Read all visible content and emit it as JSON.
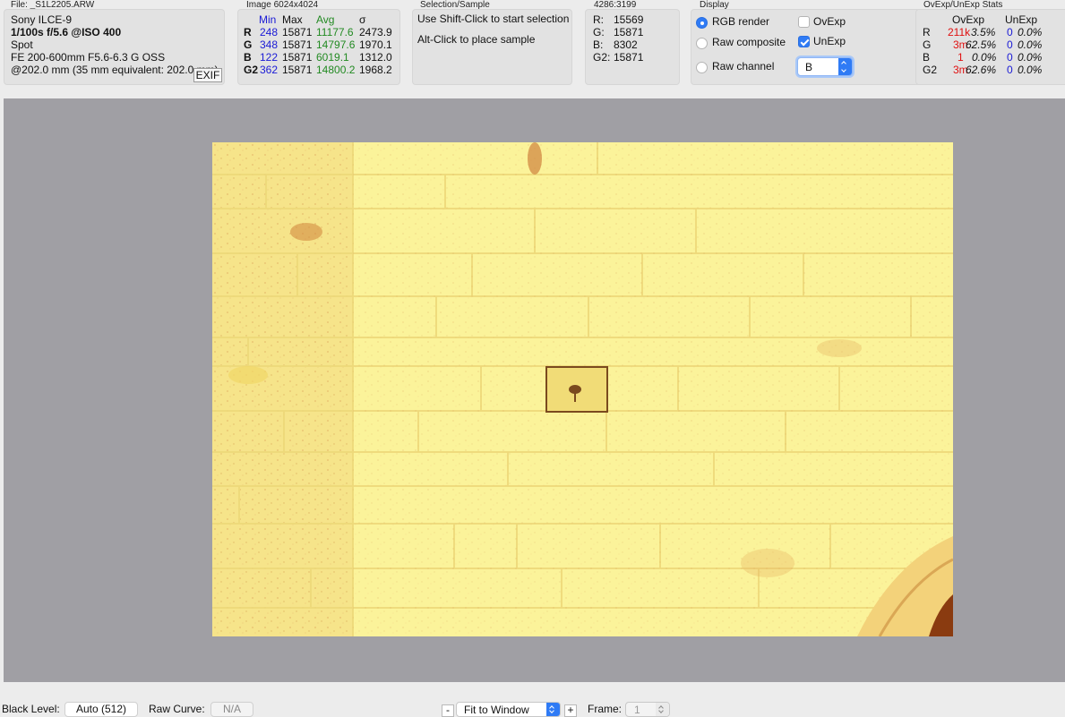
{
  "file_panel": {
    "title": "File: _S1L2205.ARW",
    "camera": "Sony ILCE-9",
    "exposure": "1/100s f/5.6 @ISO 400",
    "metering": "Spot",
    "lens": "FE 200-600mm F5.6-6.3 G OSS",
    "focal": "@202.0 mm (35 mm equivalent: 202.0 mm)",
    "exif_button": "EXIF"
  },
  "image_panel": {
    "title": "Image 6024x4024",
    "headers": {
      "min": "Min",
      "max": "Max",
      "avg": "Avg",
      "sigma": "σ"
    },
    "rows": [
      {
        "channel": "R",
        "min": "248",
        "max": "15871",
        "avg": "11177.6",
        "sigma": "2473.9"
      },
      {
        "channel": "G",
        "min": "348",
        "max": "15871",
        "avg": "14797.6",
        "sigma": "1970.1"
      },
      {
        "channel": "B",
        "min": "122",
        "max": "15871",
        "avg": "6019.1",
        "sigma": "1312.0"
      },
      {
        "channel": "G2",
        "min": "362",
        "max": "15871",
        "avg": "14800.2",
        "sigma": "1968.2"
      }
    ]
  },
  "selection_panel": {
    "title": "Selection/Sample",
    "line1": "Use Shift-Click to start selection",
    "line2": "Alt-Click to place sample"
  },
  "sample_panel": {
    "title": "4286:3199",
    "rows": [
      {
        "label": "R:",
        "value": "15569"
      },
      {
        "label": "G:",
        "value": "15871"
      },
      {
        "label": "B:",
        "value": "8302"
      },
      {
        "label": "G2:",
        "value": "15871"
      }
    ]
  },
  "display_panel": {
    "title": "Display",
    "rgb_render": "RGB render",
    "raw_composite": "Raw composite",
    "raw_channel": "Raw channel",
    "ovexp": "OvExp",
    "unexp": "UnExp",
    "channel_value": "B",
    "selected_mode": "RGB render",
    "ovexp_checked": false,
    "unexp_checked": true
  },
  "stats_panel": {
    "title": "OvExp/UnExp Stats",
    "headers": {
      "ovexp": "OvExp",
      "unexp": "UnExp"
    },
    "rows": [
      {
        "channel": "R",
        "ov_count": "211k",
        "ov_pct": "3.5%",
        "un_count": "0",
        "un_pct": "0.0%"
      },
      {
        "channel": "G",
        "ov_count": "3m",
        "ov_pct": "62.5%",
        "un_count": "0",
        "un_pct": "0.0%"
      },
      {
        "channel": "B",
        "ov_count": "1",
        "ov_pct": "0.0%",
        "un_count": "0",
        "un_pct": "0.0%"
      },
      {
        "channel": "G2",
        "ov_count": "3m",
        "ov_pct": "62.6%",
        "un_count": "0",
        "un_pct": "0.0%"
      }
    ]
  },
  "bottom_bar": {
    "black_level_label": "Black Level:",
    "black_level_value": "Auto (512)",
    "raw_curve_label": "Raw Curve:",
    "raw_curve_value": "N/A",
    "zoom_minus": "-",
    "zoom_value": "Fit to Window",
    "zoom_plus": "+",
    "frame_label": "Frame:",
    "frame_value": "1"
  },
  "colors": {
    "accent": "#2f7bf5",
    "min_blue": "#1a1ad6",
    "avg_green": "#228a22",
    "overexposed_red": "#e01010",
    "viewer_gray": "#a09fa4",
    "image_yellow": "#fbf49c"
  }
}
